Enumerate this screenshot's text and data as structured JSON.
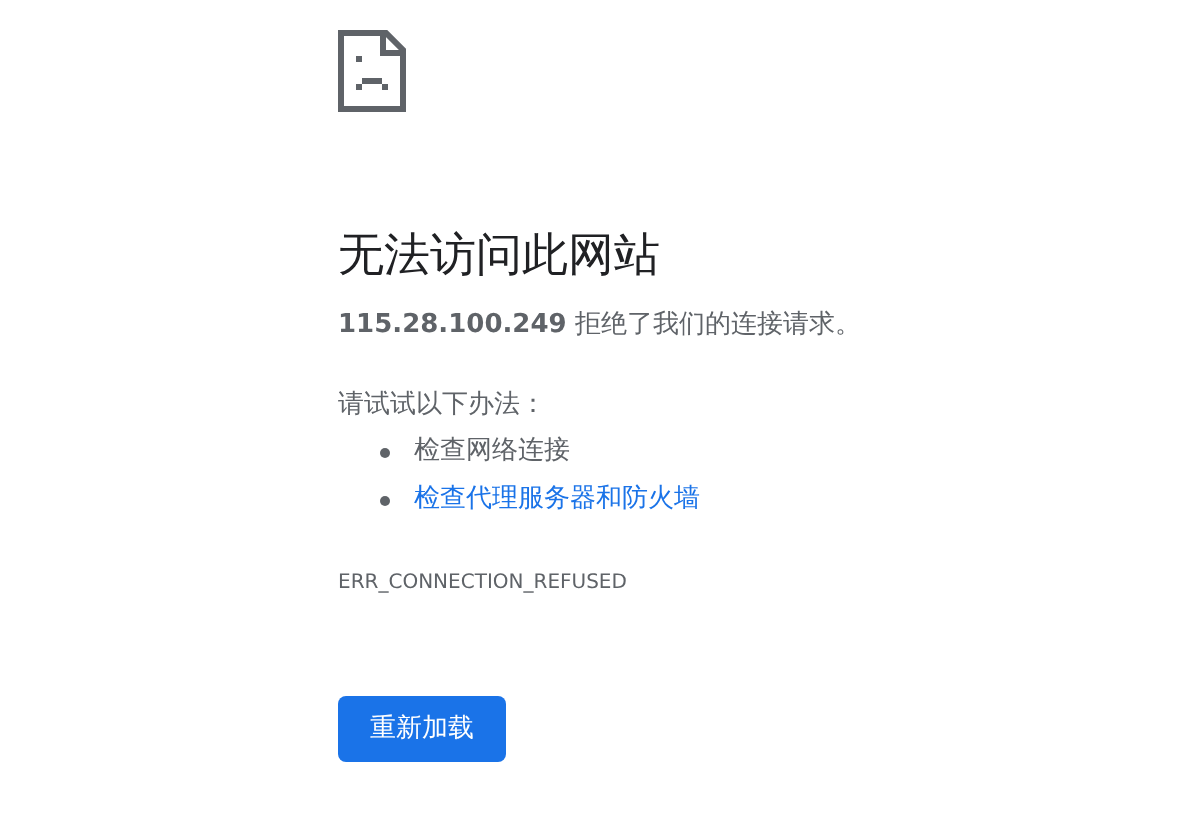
{
  "heading": "无法访问此网站",
  "message": "**115.28.100.249** 拒绝了我们的连接请求。",
  "suggestions_title": "请试试以下办法：",
  "suggestions": [
    {
      "kind": "text",
      "label": "检查网络连接"
    },
    {
      "kind": "link",
      "label": "检查代理服务器和防火墙"
    }
  ],
  "error_code": "ERR_CONNECTION_REFUSED",
  "reload_button": "重新加载"
}
